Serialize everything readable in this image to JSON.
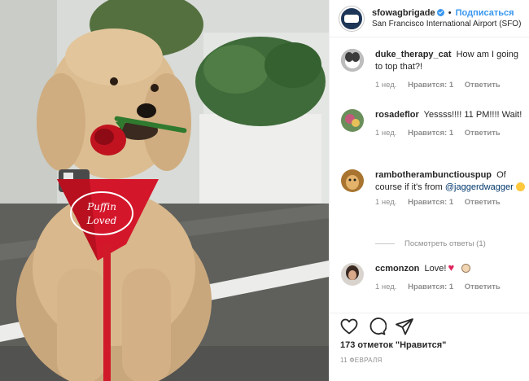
{
  "header": {
    "username": "sfowagbrigade",
    "separator": "•",
    "follow_label": "Подписаться",
    "location": "San Francisco International Airport (SFO)"
  },
  "comments": [
    {
      "username": "duke_therapy_cat",
      "text": "How am I going to top that?!",
      "time": "1 нед.",
      "likes": "Нравится: 1",
      "reply_label": "Ответить"
    },
    {
      "username": "rosadeflor",
      "text": "Yessss!!!! 11 PM!!!! Wait!",
      "time": "1 нед.",
      "likes": "Нравится: 1",
      "reply_label": "Ответить"
    },
    {
      "username": "ramboth­eramb­uncti­ouspup",
      "username_display": "ramboth eramb uncti ouspup",
      "text_before": "Of course if it's from",
      "mention": "@jaggerdwagger",
      "time": "1 нед.",
      "likes": "Нравится: 1",
      "reply_label": "Ответить",
      "view_replies": "Посмотреть ответы (1)"
    },
    {
      "username": "ccmonzon",
      "text": "Love!",
      "time": "1 нед.",
      "likes": "Нравится: 1",
      "reply_label": "Ответить"
    }
  ],
  "actions": {
    "like_icon": "heart-icon",
    "comment_icon": "comment-bubble-icon",
    "share_icon": "paper-plane-icon",
    "likes_count": "173 отметок \"Нравится\"",
    "date": "11 ФЕВРАЛЯ"
  },
  "photo": {
    "bandana_text_line1": "Puffin",
    "bandana_text_line2": "Loved"
  },
  "colors": {
    "link": "#3897f0",
    "muted": "#8e8e8e",
    "bandana": "#d4162b"
  }
}
